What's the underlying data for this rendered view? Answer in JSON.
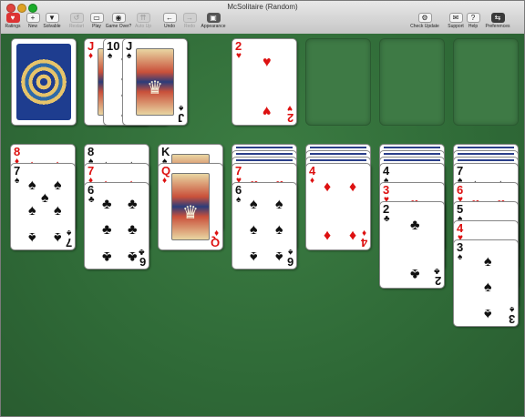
{
  "window": {
    "title": "McSolitaire (Random)"
  },
  "toolbar": {
    "items": [
      {
        "label": "Ratings",
        "icon": "heart-icon",
        "glyph": "♥",
        "enabled": true
      },
      {
        "label": "New",
        "icon": "plus-icon",
        "glyph": "+",
        "enabled": true
      },
      {
        "label": "Solvable",
        "icon": "down-arrow-icon",
        "glyph": "▼",
        "enabled": true
      },
      {
        "label": "Restart",
        "icon": "restart-icon",
        "glyph": "↺",
        "enabled": false
      },
      {
        "label": "Play",
        "icon": "play-icon",
        "glyph": "▭",
        "enabled": true
      },
      {
        "label": "Game Over?",
        "icon": "eye-icon",
        "glyph": "◉",
        "enabled": true
      },
      {
        "label": "Auto Up",
        "icon": "auto-up-icon",
        "glyph": "⇈",
        "enabled": false
      },
      {
        "label": "Undo",
        "icon": "undo-icon",
        "glyph": "←",
        "enabled": true
      },
      {
        "label": "Redo",
        "icon": "redo-icon",
        "glyph": "→",
        "enabled": false
      },
      {
        "label": "Appearance",
        "icon": "appearance-icon",
        "glyph": "▣",
        "enabled": true
      },
      {
        "label": "Check Update",
        "icon": "gear-icon",
        "glyph": "⚙",
        "enabled": true
      },
      {
        "label": "Support",
        "icon": "mail-icon",
        "glyph": "✉",
        "enabled": true
      },
      {
        "label": "Help",
        "icon": "help-icon",
        "glyph": "?",
        "enabled": true
      },
      {
        "label": "Preferences",
        "icon": "switch-icon",
        "glyph": "⇆",
        "enabled": true
      }
    ]
  },
  "stock": {
    "icon": "card-back-icon"
  },
  "waste": [
    {
      "rank": "J",
      "suit": "♦",
      "color": "red"
    },
    {
      "rank": "10",
      "suit": "♠",
      "color": "black"
    },
    {
      "rank": "J",
      "suit": "♠",
      "color": "black"
    }
  ],
  "foundations": [
    {
      "rank": "2",
      "suit": "♥",
      "color": "red"
    }
  ],
  "tableau": [
    {
      "hidden": 0,
      "cards": [
        {
          "rank": "8",
          "suit": "♦",
          "color": "red"
        },
        {
          "rank": "7",
          "suit": "♠",
          "color": "black"
        }
      ]
    },
    {
      "hidden": 0,
      "cards": [
        {
          "rank": "8",
          "suit": "♠",
          "color": "black"
        },
        {
          "rank": "7",
          "suit": "♦",
          "color": "red"
        },
        {
          "rank": "6",
          "suit": "♣",
          "color": "black"
        }
      ]
    },
    {
      "hidden": 0,
      "cards": [
        {
          "rank": "K",
          "suit": "♠",
          "color": "black"
        },
        {
          "rank": "Q",
          "suit": "♦",
          "color": "red"
        }
      ]
    },
    {
      "hidden": 3,
      "cards": [
        {
          "rank": "7",
          "suit": "♥",
          "color": "red"
        },
        {
          "rank": "6",
          "suit": "♠",
          "color": "black"
        }
      ]
    },
    {
      "hidden": 3,
      "cards": [
        {
          "rank": "4",
          "suit": "♦",
          "color": "red"
        }
      ]
    },
    {
      "hidden": 3,
      "cards": [
        {
          "rank": "4",
          "suit": "♠",
          "color": "black"
        },
        {
          "rank": "3",
          "suit": "♥",
          "color": "red"
        },
        {
          "rank": "2",
          "suit": "♣",
          "color": "black"
        }
      ]
    },
    {
      "hidden": 3,
      "cards": [
        {
          "rank": "7",
          "suit": "♠",
          "color": "black"
        },
        {
          "rank": "6",
          "suit": "♥",
          "color": "red"
        },
        {
          "rank": "5",
          "suit": "♠",
          "color": "black"
        },
        {
          "rank": "4",
          "suit": "♥",
          "color": "red"
        },
        {
          "rank": "3",
          "suit": "♠",
          "color": "black"
        }
      ]
    }
  ],
  "colors": {
    "felt": "#2f6a37",
    "red_suit": "#d11111",
    "card_back": "#1e3d8f"
  }
}
